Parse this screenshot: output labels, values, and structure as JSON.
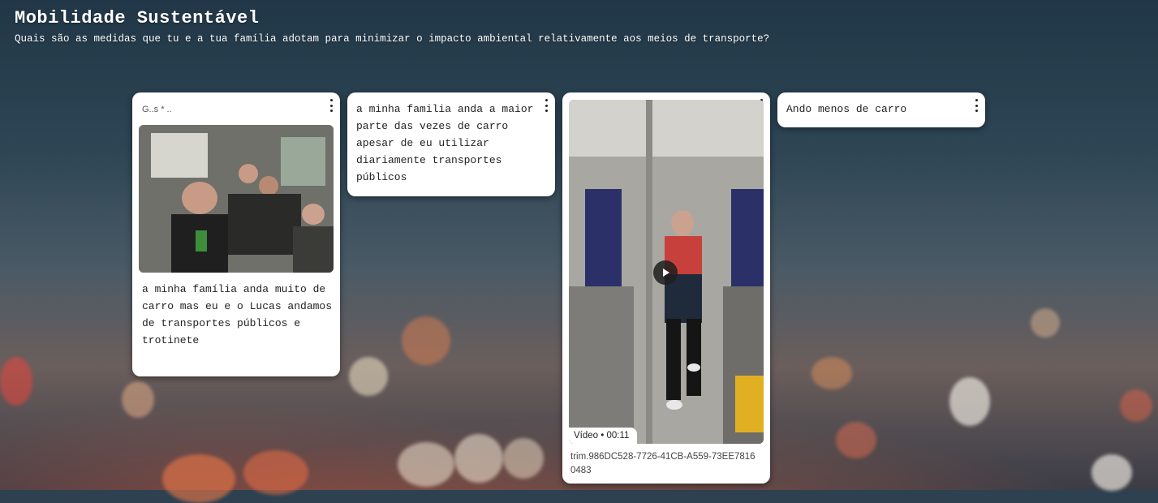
{
  "board": {
    "title": "Mobilidade Sustentável",
    "subtitle": "Quais são as medidas que tu e a tua família adotam para minimizar o impacto ambiental relativamente aos meios de transporte?"
  },
  "posts": [
    {
      "author": "G..s * ..",
      "icon": "kebab-menu-icon",
      "image": "photo-group-on-train",
      "text": "a minha família anda muito de carro mas eu e o Lucas andamos de transportes públicos e trotinete"
    },
    {
      "icon": "kebab-menu-icon",
      "text": "a minha familia anda a maior parte das vezes de carro apesar de eu utilizar diariamente transportes públicos"
    },
    {
      "icon": "kebab-menu-icon",
      "video_badge": "Vídeo • 00:11",
      "filename": "trim.986DC528-7726-41CB-A559-73EE78160483",
      "play_icon": "play-icon"
    },
    {
      "icon": "kebab-menu-icon",
      "text": "Ando menos de carro"
    }
  ]
}
